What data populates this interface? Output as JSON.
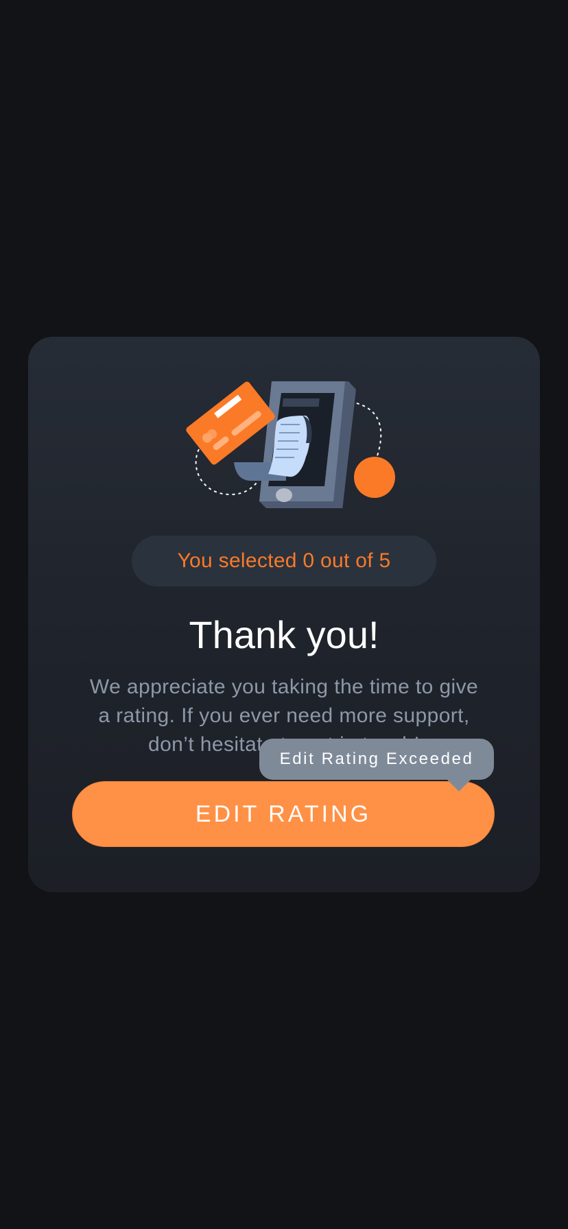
{
  "rating": {
    "selected_text": "You selected 0 out of 5",
    "selected_value": 0,
    "max_value": 5
  },
  "title": "Thank you!",
  "message_lines": [
    "We appreciate you taking the time to give",
    "a rating. If you ever need more support,",
    "don’t hesitate to get in touch!"
  ],
  "edit_button_label": "EDIT RATING",
  "tooltip_text": "Edit Rating Exceeded",
  "colors": {
    "accent": "#fb7a27",
    "button": "#ff9146",
    "card": "#262c36",
    "background": "#121317",
    "tooltip": "#7f8a99"
  },
  "illustration": {
    "icons": [
      "phone-icon",
      "receipt-icon",
      "credit-card-icon",
      "orange-dot"
    ]
  }
}
